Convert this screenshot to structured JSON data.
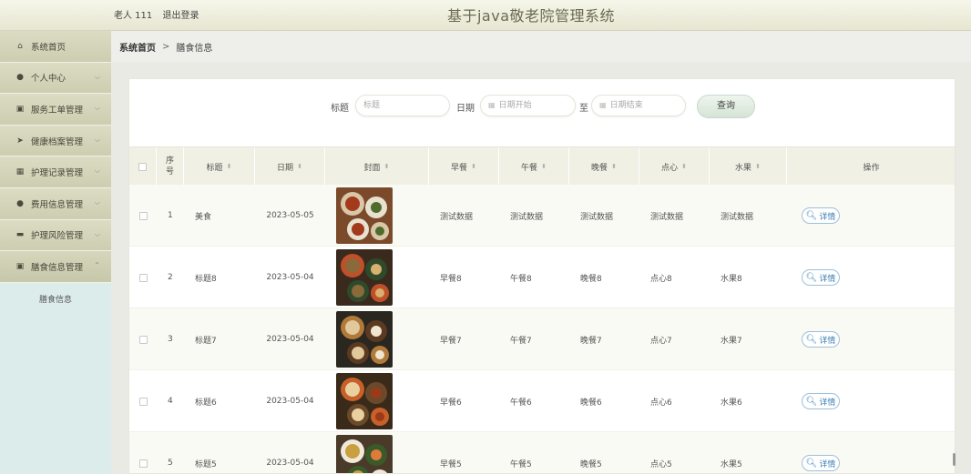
{
  "header": {
    "user": "老人 111",
    "logout": "退出登录",
    "title": "基于java敬老院管理系统"
  },
  "sidebar": {
    "items": [
      {
        "label": "系统首页",
        "icon": "home-icon",
        "glyph": "⌂",
        "chevron": ""
      },
      {
        "label": "个人中心",
        "icon": "user-icon",
        "glyph": "●",
        "chevron": "⌵"
      },
      {
        "label": "服务工单管理",
        "icon": "clipboard-icon",
        "glyph": "▣",
        "chevron": "⌵"
      },
      {
        "label": "健康档案管理",
        "icon": "send-icon",
        "glyph": "➤",
        "chevron": "⌵"
      },
      {
        "label": "护理记录管理",
        "icon": "grid-icon",
        "glyph": "▦",
        "chevron": "⌵"
      },
      {
        "label": "费用信息管理",
        "icon": "user-icon",
        "glyph": "●",
        "chevron": "⌵"
      },
      {
        "label": "护理风险管理",
        "icon": "briefcase-icon",
        "glyph": "▬",
        "chevron": "⌵"
      },
      {
        "label": "膳食信息管理",
        "icon": "checkbox-icon",
        "glyph": "▣",
        "chevron": "⌃"
      }
    ],
    "submenu": [
      "膳食信息"
    ]
  },
  "breadcrumb": {
    "home": "系统首页",
    "separator": ">",
    "current": "膳食信息"
  },
  "search": {
    "title_label": "标题",
    "title_placeholder": "标题",
    "date_label": "日期",
    "date_start_placeholder": "日期开始",
    "to_label": "至",
    "date_end_placeholder": "日期结束",
    "query_button": "查询"
  },
  "table": {
    "headers": {
      "seq": [
        "序",
        "号"
      ],
      "title": "标题",
      "date": "日期",
      "cover": "封面",
      "breakfast": "早餐",
      "lunch": "午餐",
      "dinner": "晚餐",
      "snack": "点心",
      "fruit": "水果",
      "actions": "操作"
    },
    "detail_label": "详情",
    "rows": [
      {
        "seq": "1",
        "title": "美食",
        "date": "2023-05-05",
        "breakfast": "测试数据",
        "lunch": "测试数据",
        "dinner": "测试数据",
        "snack": "测试数据",
        "fruit": "测试数据"
      },
      {
        "seq": "2",
        "title": "标题8",
        "date": "2023-05-04",
        "breakfast": "早餐8",
        "lunch": "午餐8",
        "dinner": "晚餐8",
        "snack": "点心8",
        "fruit": "水果8"
      },
      {
        "seq": "3",
        "title": "标题7",
        "date": "2023-05-04",
        "breakfast": "早餐7",
        "lunch": "午餐7",
        "dinner": "晚餐7",
        "snack": "点心7",
        "fruit": "水果7"
      },
      {
        "seq": "4",
        "title": "标题6",
        "date": "2023-05-04",
        "breakfast": "早餐6",
        "lunch": "午餐6",
        "dinner": "晚餐6",
        "snack": "点心6",
        "fruit": "水果6"
      },
      {
        "seq": "5",
        "title": "标题5",
        "date": "2023-05-04",
        "breakfast": "早餐5",
        "lunch": "午餐5",
        "dinner": "晚餐5",
        "snack": "点心5",
        "fruit": "水果5"
      }
    ]
  },
  "colors": {
    "header_bg": "#ecebd9",
    "sidebar_item_bg": "#d3d3b8",
    "table_head_bg": "#f0f0e4",
    "accent_button": "#d5e4d6",
    "detail_text": "#3b7fb2"
  }
}
